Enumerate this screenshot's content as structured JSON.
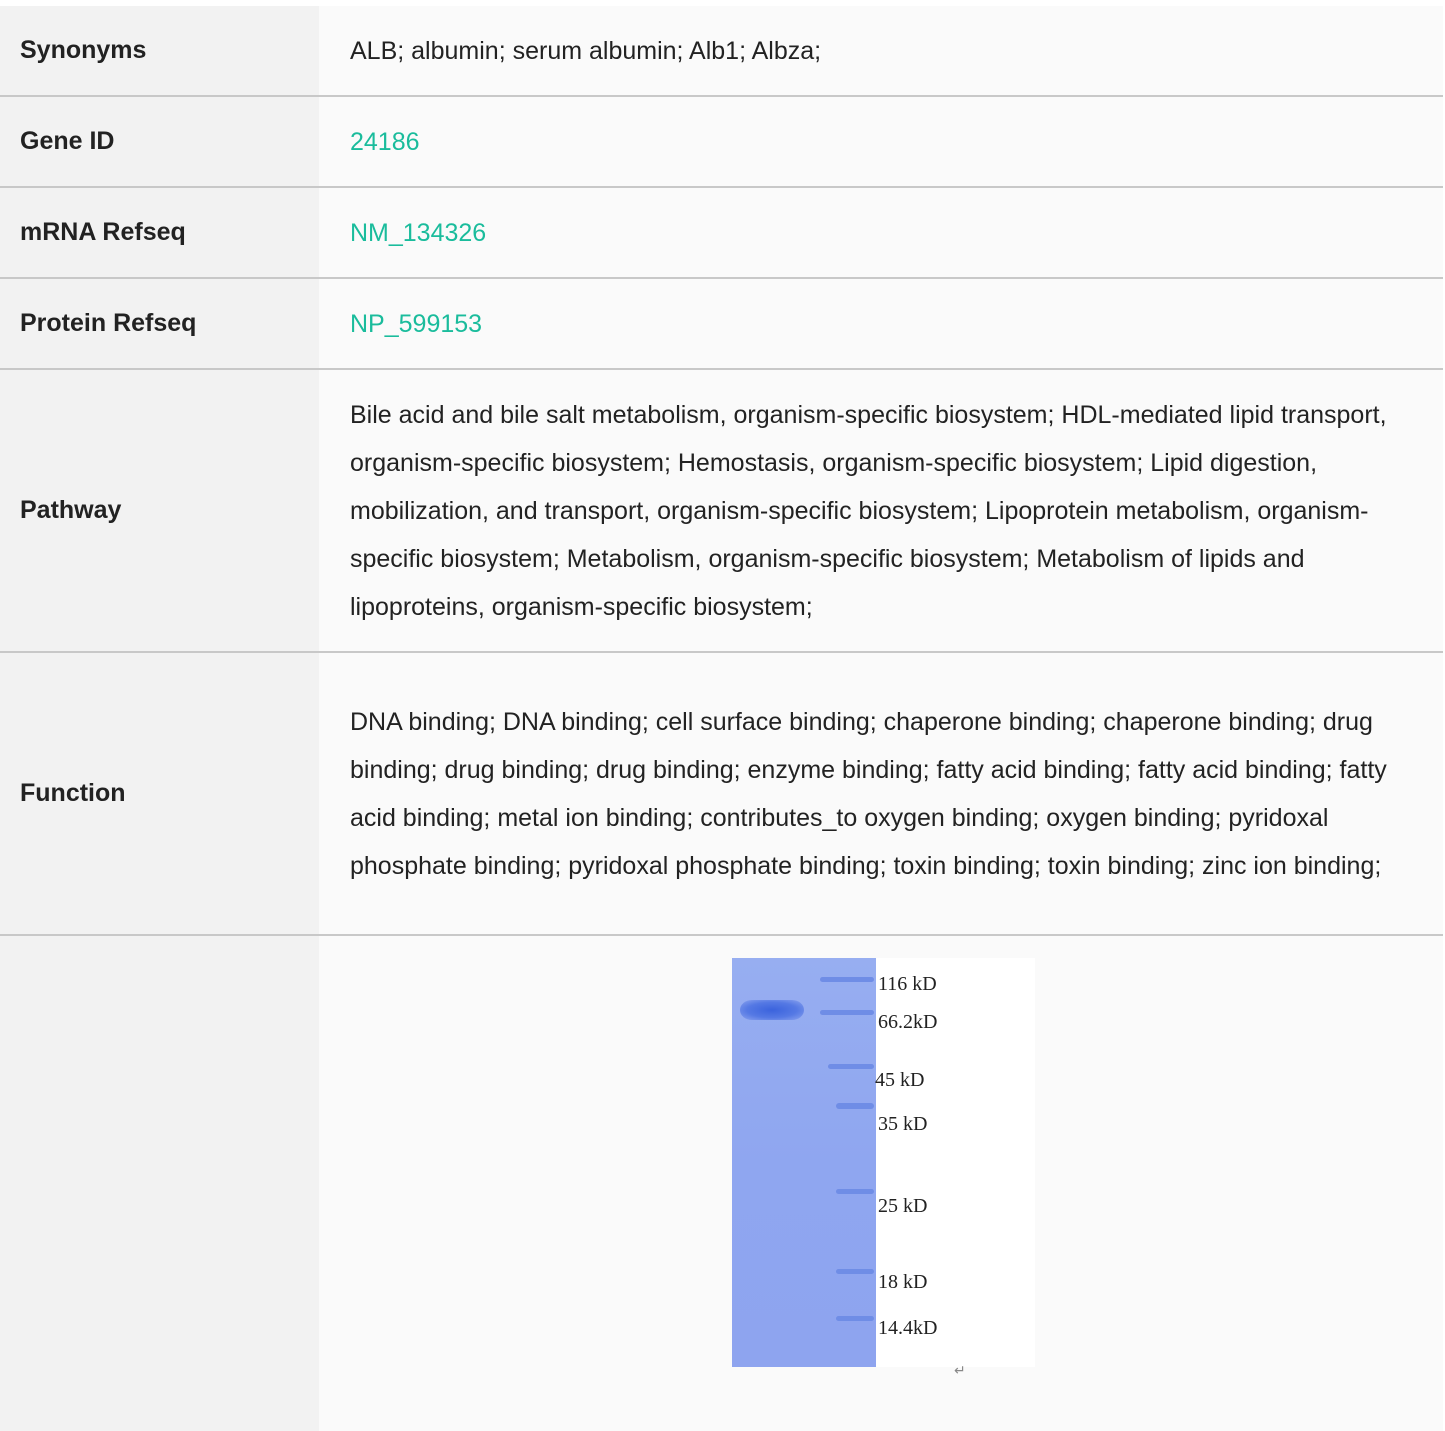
{
  "rows": [
    {
      "label": "Synonyms",
      "value": "ALB; albumin; serum albumin; Alb1; Albza;"
    },
    {
      "label": "Gene ID",
      "value": "24186"
    },
    {
      "label": "mRNA Refseq",
      "value": "NM_134326"
    },
    {
      "label": "Protein Refseq",
      "value": "NP_599153"
    },
    {
      "label": "Pathway",
      "value": "Bile acid and bile salt metabolism, organism-specific biosystem; HDL-mediated lipid transport, organism-specific biosystem; Hemostasis, organism-specific biosystem; Lipid digestion, mobilization, and transport, organism-specific biosystem; Lipoprotein metabolism, organism-specific biosystem; Metabolism, organism-specific biosystem; Metabolism of lipids and lipoproteins, organism-specific biosystem;"
    },
    {
      "label": "Function",
      "value": "DNA binding; DNA binding; cell surface binding; chaperone binding; chaperone binding; drug binding; drug binding; drug binding; enzyme binding; fatty acid binding; fatty acid binding; fatty acid binding; metal ion binding; contributes_to oxygen binding; oxygen binding; pyridoxal phosphate binding; pyridoxal phosphate binding; toxin binding; toxin binding; zinc ion binding;"
    }
  ],
  "gel": {
    "markers": [
      "116 kD",
      "66.2kD",
      "45 kD",
      "35 kD",
      "25 kD",
      "18 kD",
      "14.4kD"
    ],
    "return_mark": "↵"
  },
  "colors": {
    "link": "#1abc9c",
    "label_bg": "#f2f2f2",
    "divider": "#c8c8c8"
  }
}
